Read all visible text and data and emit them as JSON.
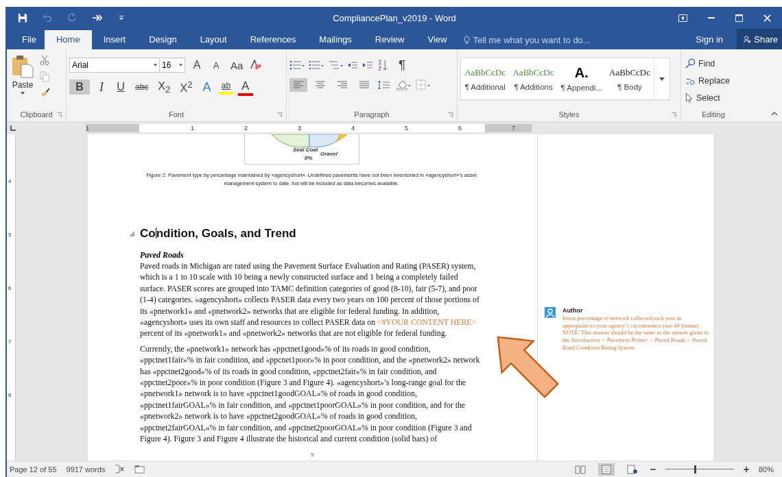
{
  "window": {
    "title": "CompliancePlan_v2019 - Word"
  },
  "quick_access": [
    {
      "kind": "save",
      "disabled": false
    },
    {
      "kind": "undo",
      "disabled": true
    },
    {
      "kind": "redo",
      "disabled": true
    },
    {
      "kind": "forward",
      "disabled": false
    },
    {
      "kind": "customize",
      "disabled": false
    }
  ],
  "tabs": [
    {
      "label": "File",
      "selected": false
    },
    {
      "label": "Home",
      "selected": true
    },
    {
      "label": "Insert",
      "selected": false
    },
    {
      "label": "Design",
      "selected": false
    },
    {
      "label": "Layout",
      "selected": false
    },
    {
      "label": "References",
      "selected": false
    },
    {
      "label": "Mailings",
      "selected": false
    },
    {
      "label": "Review",
      "selected": false
    },
    {
      "label": "View",
      "selected": false
    }
  ],
  "tell_me": {
    "placeholder": "Tell me what you want to do..."
  },
  "sign_in": "Sign in",
  "share": "Share",
  "ribbon": {
    "clipboard": {
      "paste": "Paste",
      "label": "Clipboard"
    },
    "font": {
      "name": "Arial",
      "size": "16",
      "label": "Font",
      "row1": [
        {
          "label": "A",
          "kind": "grow"
        },
        {
          "label": "A",
          "kind": "shrink"
        },
        {
          "label": "Aa",
          "kind": "case"
        }
      ],
      "row2": [
        {
          "label": "B",
          "kind": "bold",
          "selected": true
        },
        {
          "label": "I",
          "kind": "italic",
          "selected": false
        },
        {
          "label": "U",
          "kind": "underline",
          "selected": false
        },
        {
          "label": "abc",
          "kind": "strike",
          "selected": false
        },
        {
          "label": "X$_{2}$",
          "kind": "sub",
          "selected": false
        },
        {
          "label": "X$^{2}$",
          "kind": "sup",
          "selected": false
        }
      ],
      "effects": "A",
      "highlight": "ab",
      "font_color": "A"
    },
    "paragraph": {
      "label": "Paragraph",
      "pilcrow": "¶",
      "align": [
        {
          "kind": "left",
          "selected": true
        },
        {
          "kind": "center",
          "selected": false
        },
        {
          "kind": "right",
          "selected": false
        },
        {
          "kind": "justify",
          "selected": false
        }
      ]
    },
    "styles": {
      "label": "Styles",
      "items": [
        {
          "preview": "AaBbCcDc",
          "name": "¶ Additional",
          "kind": "serif-green"
        },
        {
          "preview": "AaBbCcDc",
          "name": "¶ Additions",
          "kind": "serif-green"
        },
        {
          "preview": "A.",
          "name": "¶ Appendi...",
          "kind": "heading"
        },
        {
          "preview": "AaBbCcDc",
          "name": "¶ Body",
          "kind": "serif"
        }
      ]
    },
    "editing": {
      "label": "Editing",
      "items": [
        {
          "label": "Find",
          "kind": "find"
        },
        {
          "label": "Replace",
          "kind": "replace"
        },
        {
          "label": "Select",
          "kind": "select"
        }
      ]
    }
  },
  "ruler": {
    "numbers": [
      "1",
      "1",
      "2",
      "3",
      "4",
      "5",
      "6",
      "7"
    ]
  },
  "vertical_ruler": {
    "numbers": [
      "4",
      "5",
      "6",
      "7",
      "8"
    ]
  },
  "document": {
    "figure": {
      "labels": [
        "Seal Coat",
        "8%",
        "Gravel"
      ]
    },
    "caption": "Figure 2: Pavement type by percentage maintained by «agencyshort». Undefined pavements have not been inventoried in «agencyshort»’s asset management system to date, but will be included as data becomes available.",
    "heading": {
      "before_cursor": "Co",
      "after_cursor": "ndition, Goals, and Trend"
    },
    "subheading": "Paved Roads",
    "paragraphs": [
      {
        "parts": [
          {
            "kind": "text",
            "text": "Paved roads in Michigan are rated using the Pavement Surface Evaluation and Rating (PASER) system, which is a 1 to 10 scale with 10 being a newly constructed surface and 1 being a completely failed surface. PASER scores are grouped into TAMC definition categories of good (8-10), fair (5-7), and poor (1-4) categories. «agencyshort» collects PASER data every two years on 100 percent of those portions of its «pnetwork1» and «pnetwork2» networks that are eligible for federal funding. In addition, «agencyshort» uses its own staff and resources to collect PASER data on "
          },
          {
            "kind": "placeholder",
            "text": "<#YOUR CONTENT HERE>"
          },
          {
            "kind": "text",
            "text": " percent of its «pnetwork1» and «pnetwork2» networks that are not eligible for federal funding."
          }
        ]
      },
      {
        "parts": [
          {
            "kind": "text",
            "text": "Currently, the «pnetwork1» network has «ppctnet1good»% of its roads in good condition, «ppctnet1fair»% in fair condition, and «ppcnet1poor»% in poor condition, and the «pnetwork2» network has «ppctnet2good»% of its roads in good condition, «ppctnet2fair»% in fair condition, and «ppctnet2poor»% in poor condition (Figure 3 and Figure 4). «agencyshort»’s long-range goal for the «pnetwork1» network is to have «ppctnet1goodGOAL»% of roads in good condition, «ppctnet1fairGOAL»% in fair condition, and «ppctnet1poorGOAL»% in poor condition, and for the «pnetwork2» network is to have «ppctnet2goodGOAL»% of roads in good condition, «ppctnet2fairGOAL»% in fair condition, and «ppctnet2poorGOAL»% in poor condition (Figure 3 and Figure 4). Figure 3 and Figure 4 illustrate the historical and current condition (solid bars) of"
          }
        ]
      }
    ],
    "page_number": "5",
    "comment": {
      "author": "Author",
      "paragraphs": [
        "Insert percentage of network collected each year as appropriate to your agency’s circumstance (use ## format)",
        "NOTE: This answer should be the same as the answer given in the *Introduction > Pavement Primer > Paved Roads > Paved Road Condition Rating System.*"
      ]
    }
  },
  "status_bar": {
    "page": "Page 12 of 55",
    "words": "9917 words",
    "zoom": "80%",
    "zoom_slider": {
      "level": 0.43
    },
    "view": [
      {
        "kind": "read",
        "selected": false
      },
      {
        "kind": "print",
        "selected": true
      },
      {
        "kind": "web",
        "selected": false
      }
    ]
  }
}
